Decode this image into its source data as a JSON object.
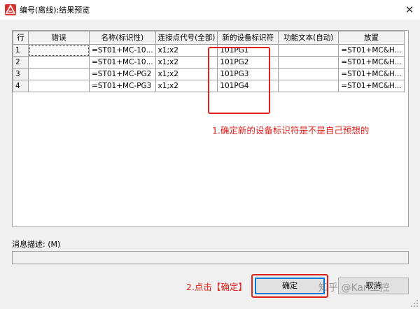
{
  "window": {
    "title": "编号(离线):结果预览",
    "close_label": "✕"
  },
  "table": {
    "columns": [
      "行",
      "错误",
      "名称(标识性)",
      "连接点代号(全部)",
      "新的设备标识符",
      "功能文本(自动)",
      "放置"
    ],
    "rows": [
      {
        "row": "1",
        "error": "",
        "name": "=ST01+MC-10...",
        "connection": "x1;x2",
        "new_id": "101PG1",
        "function_text": "",
        "placement": "=ST01+MC&H..."
      },
      {
        "row": "2",
        "error": "",
        "name": "=ST01+MC-10...",
        "connection": "x1;x2",
        "new_id": "101PG2",
        "function_text": "",
        "placement": "=ST01+MC&H..."
      },
      {
        "row": "3",
        "error": "",
        "name": "=ST01+MC-PG2",
        "connection": "x1;x2",
        "new_id": "101PG3",
        "function_text": "",
        "placement": "=ST01+MC&H..."
      },
      {
        "row": "4",
        "error": "",
        "name": "=ST01+MC-PG3",
        "connection": "x1;x2",
        "new_id": "101PG4",
        "function_text": "",
        "placement": "=ST01+MC&H..."
      }
    ]
  },
  "annotations": {
    "note1": "1.确定新的设备标识符是不是自己预想的",
    "note2": "2.点击【确定】"
  },
  "message": {
    "label": "消息描述: (M)",
    "value": ""
  },
  "buttons": {
    "ok": "确定",
    "cancel": "取消"
  },
  "watermark": "知乎 @Karl工控",
  "colors": {
    "annotation_red": "#e0201c",
    "focus_blue": "#0078d7",
    "app_icon": "#d8332f"
  }
}
